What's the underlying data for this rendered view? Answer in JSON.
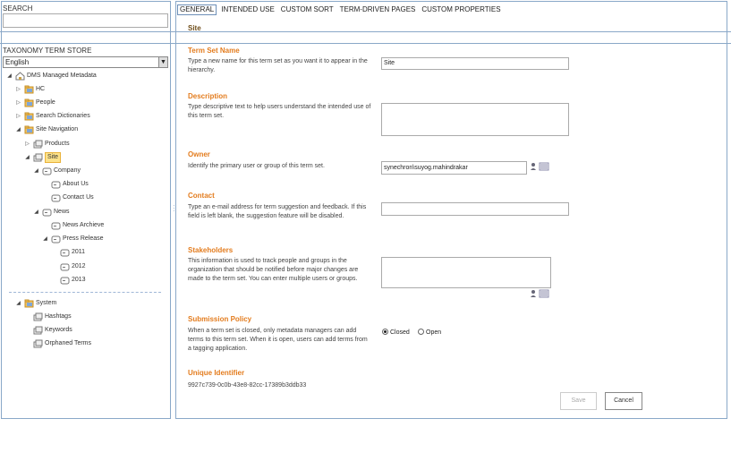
{
  "search": {
    "label": "SEARCH",
    "value": ""
  },
  "store": {
    "label": "TAXONOMY TERM STORE",
    "language": "English"
  },
  "tree": [
    {
      "label": "DMS Managed Metadata",
      "icon": "store-icon"
    },
    {
      "label": "HC",
      "icon": "group-icon"
    },
    {
      "label": "People",
      "icon": "group-icon"
    },
    {
      "label": "Search Dictionaries",
      "icon": "group-icon"
    },
    {
      "label": "Site Navigation",
      "icon": "group-icon"
    },
    {
      "label": "Products",
      "icon": "termset-icon"
    },
    {
      "label": "Site",
      "icon": "termset-icon"
    },
    {
      "label": "Company",
      "icon": "term-icon"
    },
    {
      "label": "About Us",
      "icon": "term-icon"
    },
    {
      "label": "Contact Us",
      "icon": "term-icon"
    },
    {
      "label": "News",
      "icon": "term-icon"
    },
    {
      "label": "News Archieve",
      "icon": "term-icon"
    },
    {
      "label": "Press Release",
      "icon": "term-icon"
    },
    {
      "label": "2011",
      "icon": "term-icon"
    },
    {
      "label": "2012",
      "icon": "term-icon"
    },
    {
      "label": "2013",
      "icon": "term-icon"
    },
    {
      "label": "System",
      "icon": "group-icon"
    },
    {
      "label": "Hashtags",
      "icon": "termset-icon"
    },
    {
      "label": "Keywords",
      "icon": "termset-icon"
    },
    {
      "label": "Orphaned Terms",
      "icon": "termset-icon"
    }
  ],
  "tabs": [
    "GENERAL",
    "INTENDED USE",
    "CUSTOM SORT",
    "TERM-DRIVEN PAGES",
    "CUSTOM PROPERTIES"
  ],
  "page_title": "Site",
  "sections": {
    "name": {
      "heading": "Term Set Name",
      "desc": "Type a new name for this term set as you want it to appear in the hierarchy.",
      "value": "Site"
    },
    "description": {
      "heading": "Description",
      "desc": "Type descriptive text to help users understand the intended use of this term set.",
      "value": ""
    },
    "owner": {
      "heading": "Owner",
      "desc": "Identify the primary user or group of this term set.",
      "value": "synechron\\suyog.mahindrakar"
    },
    "contact": {
      "heading": "Contact",
      "desc": "Type an e-mail address for term suggestion and feedback. If this field is left blank, the suggestion feature will be disabled.",
      "value": ""
    },
    "stakeholders": {
      "heading": "Stakeholders",
      "desc": "This information is used to track people and groups in the organization that should be notified before major changes are made to the term set. You can enter multiple users or groups.",
      "value": ""
    },
    "submission": {
      "heading": "Submission Policy",
      "desc": "When a term set is closed, only metadata managers can add terms to this term set. When it is open, users can add terms from a tagging application.",
      "closed": "Closed",
      "open": "Open",
      "selected": "Closed"
    },
    "uid": {
      "heading": "Unique Identifier",
      "value": "9927c739-0c0b-43e8-82cc-17389b3ddb33"
    }
  },
  "buttons": {
    "save": "Save",
    "cancel": "Cancel"
  }
}
